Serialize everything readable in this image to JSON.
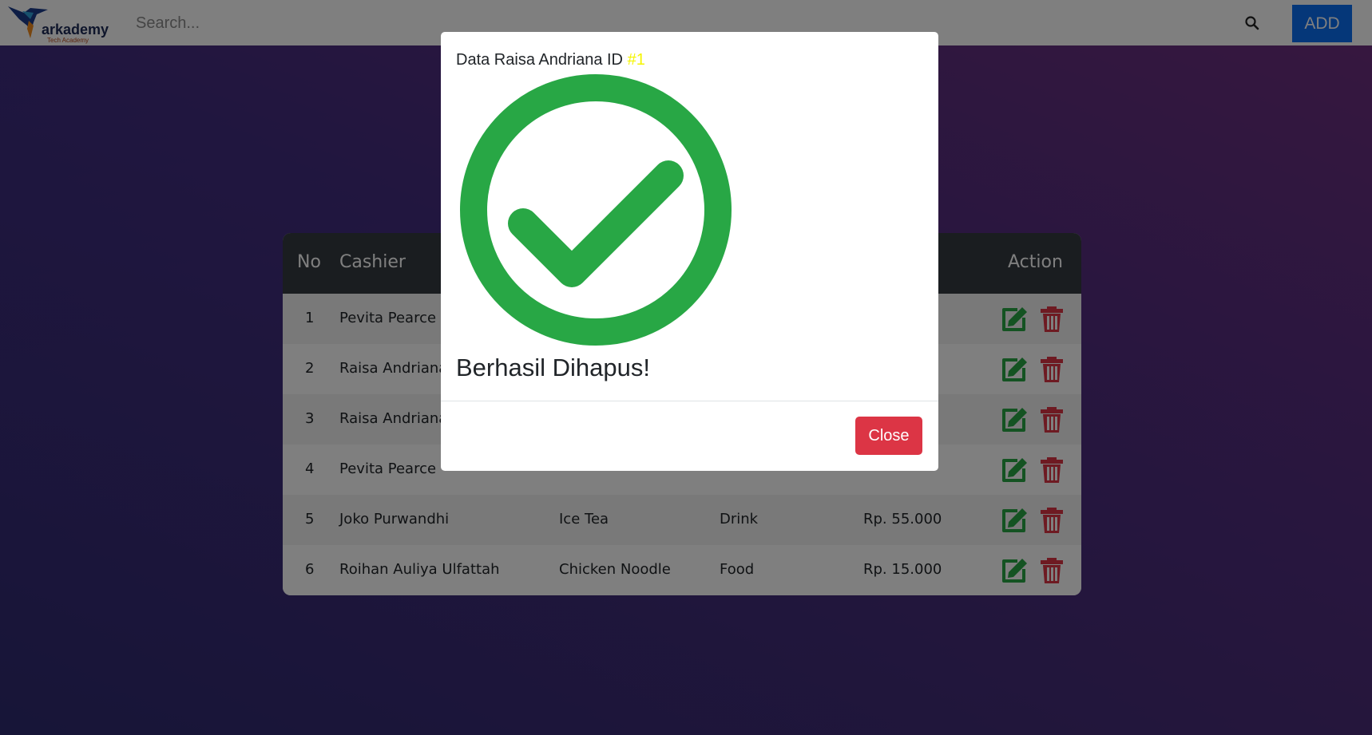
{
  "navbar": {
    "logo_text": "arkademy",
    "logo_subtext": "Tech Academy",
    "search_placeholder": "Search...",
    "add_label": "ADD"
  },
  "table": {
    "headers": {
      "no": "No",
      "cashier": "Cashier",
      "action": "Action"
    },
    "rows": [
      {
        "no": "1",
        "cashier": "Pevita Pearce",
        "product": "",
        "category": "",
        "price": ""
      },
      {
        "no": "2",
        "cashier": "Raisa Andriana",
        "product": "",
        "category": "",
        "price": ""
      },
      {
        "no": "3",
        "cashier": "Raisa Andriana",
        "product": "",
        "category": "",
        "price": ""
      },
      {
        "no": "4",
        "cashier": "Pevita Pearce",
        "product": "",
        "category": "",
        "price": ""
      },
      {
        "no": "5",
        "cashier": "Joko Purwandhi",
        "product": "Ice Tea",
        "category": "Drink",
        "price": "Rp. 55.000"
      },
      {
        "no": "6",
        "cashier": "Roihan Auliya Ulfattah",
        "product": "Chicken Noodle",
        "category": "Food",
        "price": "Rp. 15.000"
      }
    ]
  },
  "modal": {
    "title": "Data Raisa Andriana ID",
    "id": "#1",
    "message": "Berhasil Dihapus!",
    "close_label": "Close"
  },
  "colors": {
    "success": "#28a745",
    "danger": "#dc3545",
    "edit": "#28a745",
    "primary": "#0b6ef3"
  }
}
